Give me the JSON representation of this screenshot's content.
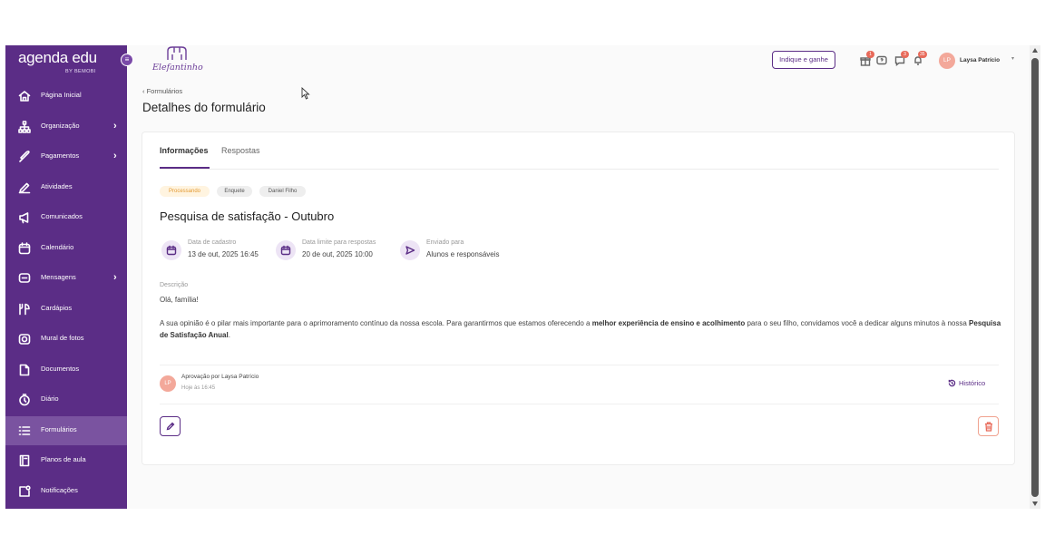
{
  "sidebar": {
    "brand": "agenda edu",
    "by_line": "BY BEMOBI",
    "items": [
      {
        "label": "Página Inicial",
        "icon": "home-icon",
        "chevron": ""
      },
      {
        "label": "Organização",
        "icon": "sitemap-icon",
        "chevron": "›"
      },
      {
        "label": "Pagamentos",
        "icon": "payments-icon",
        "chevron": "›"
      },
      {
        "label": "Atividades",
        "icon": "pencil-icon",
        "chevron": ""
      },
      {
        "label": "Comunicados",
        "icon": "megaphone-icon",
        "chevron": ""
      },
      {
        "label": "Calendário",
        "icon": "calendar-icon",
        "chevron": ""
      },
      {
        "label": "Mensagens",
        "icon": "message-icon",
        "chevron": "›"
      },
      {
        "label": "Cardápios",
        "icon": "menu-food-icon",
        "chevron": ""
      },
      {
        "label": "Mural de fotos",
        "icon": "camera-icon",
        "chevron": ""
      },
      {
        "label": "Documentos",
        "icon": "document-icon",
        "chevron": ""
      },
      {
        "label": "Diário",
        "icon": "clock-icon",
        "chevron": ""
      },
      {
        "label": "Formulários",
        "icon": "list-icon",
        "chevron": ""
      },
      {
        "label": "Planos de aula",
        "icon": "book-icon",
        "chevron": ""
      },
      {
        "label": "Notificações",
        "icon": "notification-icon",
        "chevron": ""
      }
    ],
    "active_item": "Formulários"
  },
  "topbar": {
    "school_name": "Elefantinho",
    "referral_button": "Indique e ganhe",
    "badges": {
      "gift": "1",
      "chat": "3",
      "notifications": "35"
    },
    "user_initials": "LP",
    "user_name": "Laysa Patrício"
  },
  "page": {
    "breadcrumb": "‹ Formulários",
    "title": "Detalhes do formulário"
  },
  "tabs": [
    {
      "label": "Informações",
      "active": true
    },
    {
      "label": "Respostas",
      "active": false
    }
  ],
  "form": {
    "tags": [
      "Processando",
      "Enquete",
      "Daniel Filho"
    ],
    "title": "Pesquisa de satisfação - Outubro",
    "meta": [
      {
        "label": "Data de cadastro",
        "value": "13 de out, 2025 16:45",
        "icon": "calendar-icon"
      },
      {
        "label": "Data limite para respostas",
        "value": "20 de out, 2025 10:00",
        "icon": "calendar-icon"
      },
      {
        "label": "Enviado para",
        "value": "Alunos e responsáveis",
        "icon": "send-icon"
      }
    ],
    "description_label": "Descrição",
    "description_greeting": "Olá, família!",
    "description_body": {
      "part1": "A sua opinião é o pilar mais importante para o aprimoramento contínuo da nossa escola. Para garantirmos que estamos oferecendo a ",
      "bold1": "melhor experiência de ensino e acolhimento",
      "part2": " para o seu filho, convidamos você a dedicar alguns minutos à nossa ",
      "bold2": "Pesquisa de Satisfação Anual",
      "part3": "."
    },
    "approval": {
      "initials": "LP",
      "title": "Aprovação por Laysa Patrício",
      "time": "Hoje às 16:45"
    },
    "history_link": "Histórico"
  },
  "colors": {
    "sidebar": "#5b2d86",
    "accent": "#5b2d86",
    "badge": "#e86a5a",
    "status_tag": "#e39a33"
  }
}
